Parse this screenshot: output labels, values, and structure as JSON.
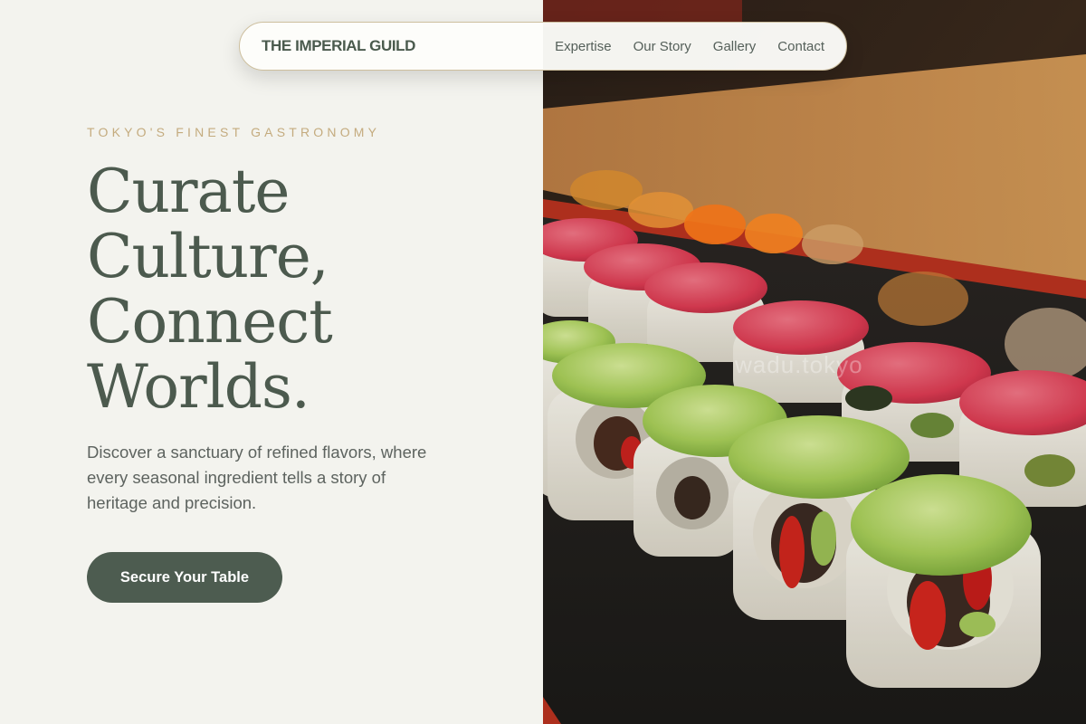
{
  "brand": {
    "name": "THE IMPERIAL GUILD"
  },
  "nav": {
    "links": [
      "Expertise",
      "Our Story",
      "Gallery",
      "Contact"
    ]
  },
  "hero": {
    "eyebrow": "TOKYO'S FINEST GASTRONOMY",
    "headline_lines": [
      "Curate",
      "Culture,",
      "Connect",
      "Worlds."
    ],
    "lede": "Discover a sanctuary of refined flavors, where every seasonal ingredient tells a story of heritage and precision.",
    "cta_label": "Secure Your Table"
  },
  "photo": {
    "watermark": "wadu.tokyo"
  },
  "colors": {
    "background": "#f3f3ee",
    "accent_green": "#4d5c50",
    "gold": "#c4ab7e",
    "text_body": "#5d635f"
  }
}
